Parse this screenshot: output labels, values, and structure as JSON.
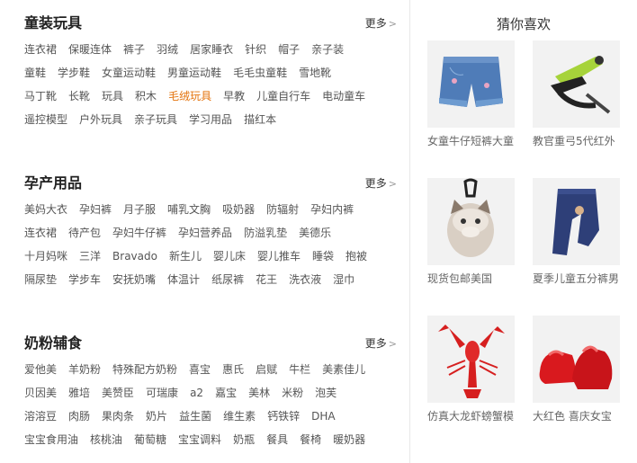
{
  "sections": [
    {
      "title": "童装玩具",
      "more": "更多",
      "rows": [
        [
          "连衣裙",
          "保暖连体",
          "裤子",
          "羽绒",
          "居家睡衣",
          "针织",
          "帽子",
          "亲子装"
        ],
        [
          "童鞋",
          "学步鞋",
          "女童运动鞋",
          "男童运动鞋",
          "毛毛虫童鞋",
          "雪地靴"
        ],
        [
          "马丁靴",
          "长靴",
          "玩具",
          "积木",
          "毛绒玩具",
          "早教",
          "儿童自行车",
          "电动童车"
        ],
        [
          "遥控模型",
          "户外玩具",
          "亲子玩具",
          "学习用品",
          "描红本"
        ]
      ],
      "highlight": "毛绒玩具"
    },
    {
      "title": "孕产用品",
      "more": "更多",
      "rows": [
        [
          "美妈大衣",
          "孕妇裤",
          "月子服",
          "哺乳文胸",
          "吸奶器",
          "防辐射",
          "孕妇内裤"
        ],
        [
          "连衣裙",
          "待产包",
          "孕妇牛仔裤",
          "孕妇营养品",
          "防溢乳垫",
          "美德乐"
        ],
        [
          "十月妈咪",
          "三洋",
          "Bravado",
          "新生儿",
          "婴儿床",
          "婴儿推车",
          "睡袋",
          "抱被"
        ],
        [
          "隔尿垫",
          "学步车",
          "安抚奶嘴",
          "体温计",
          "纸尿裤",
          "花王",
          "洗衣液",
          "湿巾"
        ]
      ],
      "highlight": ""
    },
    {
      "title": "奶粉辅食",
      "more": "更多",
      "rows": [
        [
          "爱他美",
          "羊奶粉",
          "特殊配方奶粉",
          "喜宝",
          "惠氏",
          "启赋",
          "牛栏",
          "美素佳儿"
        ],
        [
          "贝因美",
          "雅培",
          "美赞臣",
          "可瑞康",
          "a2",
          "嘉宝",
          "美林",
          "米粉",
          "泡芙"
        ],
        [
          "溶溶豆",
          "肉肠",
          "果肉条",
          "奶片",
          "益生菌",
          "维生素",
          "钙铁锌",
          "DHA"
        ],
        [
          "宝宝食用油",
          "核桃油",
          "葡萄糖",
          "宝宝调料",
          "奶瓶",
          "餐具",
          "餐椅",
          "暖奶器"
        ]
      ],
      "highlight": ""
    }
  ],
  "guess": {
    "title": "猜你喜欢",
    "products": [
      {
        "name": "女童牛仔短裤大童",
        "image": "denim-shorts-image"
      },
      {
        "name": "教官重弓5代红外",
        "image": "slingshot-image"
      },
      {
        "name": "现货包邮美国",
        "image": "cat-plush-keychain-image"
      },
      {
        "name": "夏季儿童五分裤男",
        "image": "navy-pants-image"
      },
      {
        "name": "仿真大龙虾螃蟹模",
        "image": "red-lobster-toy-image"
      },
      {
        "name": "大红色 喜庆女宝",
        "image": "red-baby-shoes-image"
      }
    ]
  }
}
